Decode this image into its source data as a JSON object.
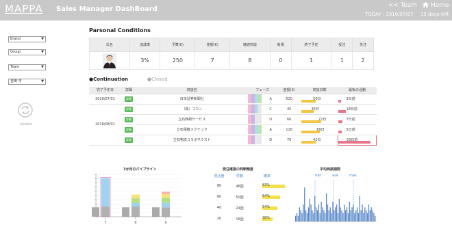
{
  "header": {
    "logo": "MAPPA",
    "title": "Sales Manager DashBoard",
    "team_link": "<< Team",
    "home_link": "Home",
    "today": "TODAY : 2016/07/07",
    "days_left": "15 days left"
  },
  "filters": [
    {
      "value": "Brand"
    },
    {
      "value": "Group"
    },
    {
      "value": "Team"
    },
    {
      "value": "吉田 守"
    }
  ],
  "update_label": "Update",
  "personal": {
    "section_title": "Parsonal Conditions",
    "headers": [
      "氏名",
      "達成率",
      "予算(K)",
      "金額(K)",
      "継続商談",
      "新規",
      "終了予定",
      "受注",
      "失注"
    ],
    "values": [
      "3%",
      "250",
      "7",
      "8",
      "0",
      "1",
      "1",
      "2"
    ]
  },
  "continuation": {
    "tab_active": "●Continuation",
    "tab_inactive": "●Closed",
    "headers": [
      "完了予定日",
      "詳細",
      "商談名",
      "フェーズ",
      "金額(K)",
      "商談日数",
      "最後の活動"
    ],
    "detail_label": "詳細",
    "dates": [
      "2016/07/01",
      "2016/08/01"
    ],
    "rows": [
      {
        "name": "日本証券新聞社",
        "phase": "A",
        "amount": "520",
        "days": "50日",
        "days_ratio": 0.4,
        "last": "3日前",
        "last_ratio": 0.08
      },
      {
        "name": "（株）コウノ",
        "phase": "C",
        "amount": "45",
        "days": "35日",
        "days_ratio": 0.35,
        "last": "18日前",
        "last_ratio": 0.2
      },
      {
        "name": "立石西新サービス",
        "phase": "D",
        "amount": "66",
        "days": "72日",
        "days_ratio": 0.55,
        "last": "7日前",
        "last_ratio": 0.12
      },
      {
        "name": "立石電機メクテック",
        "phase": "A",
        "amount": "116",
        "days": "69日",
        "days_ratio": 0.5,
        "last": "5日前",
        "last_ratio": 0.1
      },
      {
        "name": "立石物流コラボネクスト",
        "phase": "D",
        "amount": "76",
        "days": "42日",
        "days_ratio": 0.4,
        "last": "29日前",
        "last_ratio": 0.85
      }
    ]
  },
  "charts": {
    "pipeline_title": "3か月のパイプライン",
    "pipeline_ticks": [
      "7",
      "8",
      "9"
    ],
    "precision_title": "受注確度の判断精度",
    "precision_headers": [
      "見込度",
      "件数",
      "確率"
    ],
    "precision_rows": [
      {
        "level": "80",
        "count": "48回",
        "rate": "83%",
        "ratio": 0.83
      },
      {
        "level": "60",
        "count": "50回",
        "rate": "64%",
        "ratio": 0.64
      },
      {
        "level": "40",
        "count": "24回",
        "rate": "54%",
        "ratio": 0.54
      },
      {
        "level": "20",
        "count": "16回",
        "rate": "38%",
        "ratio": 0.38
      }
    ],
    "duration_title": "平均商談期間",
    "duration_labels": [
      "min",
      "ave",
      "max"
    ]
  },
  "chart_data": [
    {
      "type": "bar",
      "title": "3か月のパイプライン",
      "categories": [
        "7",
        "8",
        "9"
      ],
      "stacks": [
        [
          {
            "v": 22,
            "c": "#b0b0b0"
          },
          {
            "v": 60,
            "c": "#9fd3ef"
          }
        ],
        [
          {
            "v": 22,
            "c": "#b0b0b0"
          },
          {
            "v": 7,
            "c": "#9fd3ef"
          },
          {
            "v": 10,
            "c": "#b5df80"
          },
          {
            "v": 8,
            "c": "#f5e27a"
          }
        ],
        [
          {
            "v": 20,
            "c": "#b0b0b0"
          },
          {
            "v": 10,
            "c": "#9fd3ef"
          },
          {
            "v": 10,
            "c": "#b5df80"
          },
          {
            "v": 8,
            "c": "#f5e27a"
          },
          {
            "v": 5,
            "c": "#f5b6b6"
          }
        ]
      ],
      "ylim": [
        0,
        90
      ]
    },
    {
      "type": "bar",
      "title": "平均商談期間",
      "values": [
        2,
        3,
        2,
        5,
        4,
        3,
        6,
        12,
        4,
        3,
        5,
        8,
        6,
        4,
        3,
        9,
        5,
        4,
        6,
        3,
        7,
        5,
        4,
        3,
        10,
        6,
        4,
        5,
        3,
        7,
        4,
        5,
        6,
        3,
        8,
        5,
        4,
        3,
        6,
        4,
        5,
        3,
        7,
        4,
        5,
        6,
        3,
        4,
        5,
        3,
        9,
        4,
        6,
        3,
        5,
        4,
        3,
        6,
        4,
        5,
        4,
        3,
        2
      ],
      "ylim": [
        0,
        14
      ]
    }
  ]
}
